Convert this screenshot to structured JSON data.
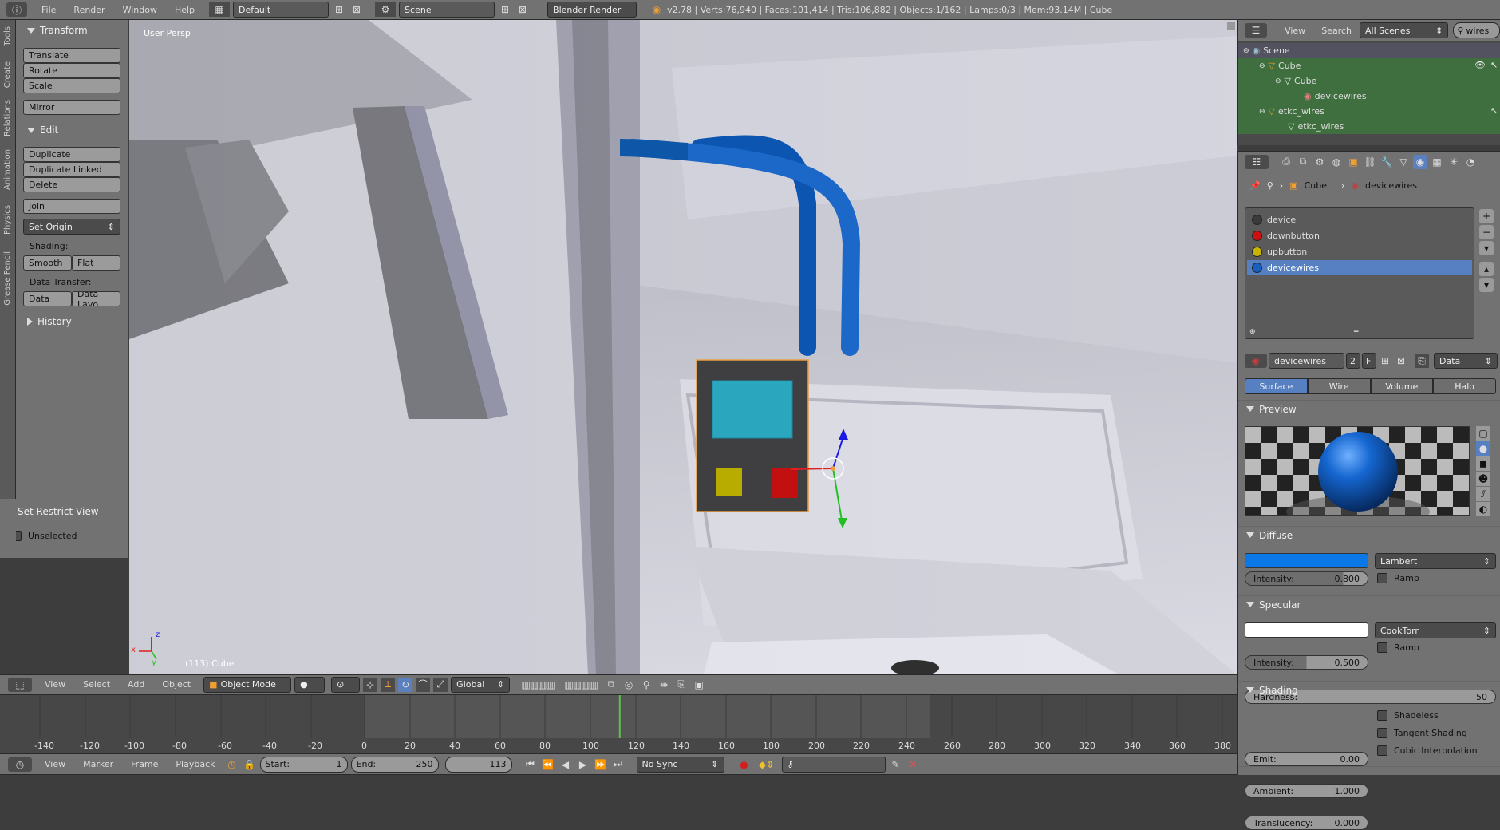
{
  "topbar": {
    "menus": [
      "File",
      "Render",
      "Window",
      "Help"
    ],
    "layout": "Default",
    "scene": "Scene",
    "engine": "Blender Render",
    "stats": "v2.78 | Verts:76,940 | Faces:101,414 | Tris:106,882 | Objects:1/162 | Lamps:0/3 | Mem:93.14M | Cube"
  },
  "side_tabs": [
    "Tools",
    "Create",
    "Relations",
    "Animation",
    "Physics",
    "Grease Pencil"
  ],
  "toolshelf": {
    "transform_title": "Transform",
    "translate": "Translate",
    "rotate": "Rotate",
    "scale": "Scale",
    "mirror": "Mirror",
    "edit_title": "Edit",
    "duplicate": "Duplicate",
    "duplicate_linked": "Duplicate Linked",
    "delete": "Delete",
    "join": "Join",
    "set_origin": "Set Origin",
    "shading_label": "Shading:",
    "smooth": "Smooth",
    "flat": "Flat",
    "data_transfer_label": "Data Transfer:",
    "data": "Data",
    "data_layout": "Data Layo",
    "history_title": "History",
    "restrict_title": "Set Restrict View",
    "unselected": "Unselected"
  },
  "viewport": {
    "view_label": "User Persp",
    "object_label": "(113) Cube",
    "axis_z": "z",
    "axis_x": "x",
    "axis_y": "y"
  },
  "view_header": {
    "menus": [
      "View",
      "Select",
      "Add",
      "Object"
    ],
    "mode": "Object Mode",
    "orientation": "Global"
  },
  "timeline": {
    "ticks": [
      "-140",
      "-120",
      "-100",
      "-80",
      "-60",
      "-40",
      "-20",
      "0",
      "20",
      "40",
      "60",
      "80",
      "100",
      "120",
      "140",
      "160",
      "180",
      "200",
      "220",
      "240",
      "260",
      "280",
      "300",
      "320",
      "340",
      "360",
      "380"
    ],
    "current_frame_value": 113,
    "menus": [
      "View",
      "Marker",
      "Frame",
      "Playback"
    ],
    "start_label": "Start:",
    "start": "1",
    "end_label": "End:",
    "end": "250",
    "frame": "113",
    "sync": "No Sync"
  },
  "outliner": {
    "menus": [
      "View",
      "Search"
    ],
    "scenes": "All Scenes",
    "search": "wires",
    "items": [
      {
        "label": "Scene",
        "level": 0
      },
      {
        "label": "Cube",
        "level": 1
      },
      {
        "label": "Cube",
        "level": 2
      },
      {
        "label": "devicewires",
        "level": 3
      },
      {
        "label": "etkc_wires",
        "level": 1
      },
      {
        "label": "etkc_wires",
        "level": 2
      }
    ]
  },
  "properties": {
    "breadcrumb_object": "Cube",
    "breadcrumb_material": "devicewires",
    "materials": [
      {
        "name": "device",
        "color": "#3a3a3a"
      },
      {
        "name": "downbutton",
        "color": "#cc1111"
      },
      {
        "name": "upbutton",
        "color": "#c8b400"
      },
      {
        "name": "devicewires",
        "color": "#1a5fc0"
      }
    ],
    "selected_material": "devicewires",
    "mat_name": "devicewires",
    "users": "2",
    "fake": "F",
    "link": "Data",
    "tabs": [
      "Surface",
      "Wire",
      "Volume",
      "Halo"
    ],
    "active_tab": "Surface",
    "preview_title": "Preview",
    "diffuse_title": "Diffuse",
    "diffuse_color": "#0a78e6",
    "diffuse_shader": "Lambert",
    "diffuse_intensity_label": "Intensity:",
    "diffuse_intensity": "0.800",
    "ramp": "Ramp",
    "specular_title": "Specular",
    "specular_color": "#ffffff",
    "specular_shader": "CookTorr",
    "specular_intensity_label": "Intensity:",
    "specular_intensity": "0.500",
    "hardness_label": "Hardness:",
    "hardness": "50",
    "shading_title": "Shading",
    "emit_label": "Emit:",
    "emit": "0.00",
    "ambient_label": "Ambient:",
    "ambient": "1.000",
    "translucency_label": "Translucency:",
    "translucency": "0.000",
    "shadeless": "Shadeless",
    "tangent": "Tangent Shading",
    "cubic": "Cubic Interpolation"
  }
}
